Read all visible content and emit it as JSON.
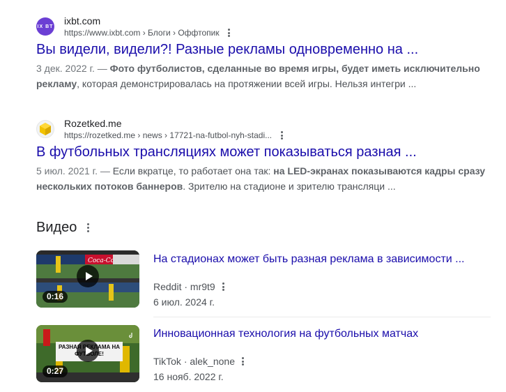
{
  "results": [
    {
      "site_name": "ixbt.com",
      "favicon_text": "IX BT",
      "url": "https://www.ixbt.com › Блоги › Оффтопик",
      "title": "Вы видели, видели?! Разные рекламы одновременно на ...",
      "date": "3 дек. 2022 г. — ",
      "snippet_bold1": "Фото футболистов, сделанные во время игры, будет иметь исключительно рекламу",
      "snippet_rest": ", которая демонстрировалась на протяжении всей игры. Нельзя интегри ..."
    },
    {
      "site_name": "Rozetked.me",
      "url": "https://rozetked.me › news › 17721-na-futbol-nyh-stadi...",
      "title": "В футбольных трансляциях может показываться разная ...",
      "date": "5 июл. 2021 г. — ",
      "snippet_plain1": "Если вкратце, то работает она так: ",
      "snippet_bold1": "на LED-экранах показываются кадры сразу нескольких потоков баннеров",
      "snippet_rest": ". Зрителю на стадионе и зрителю трансляци ..."
    }
  ],
  "video_section": {
    "heading": "Видео",
    "items": [
      {
        "title": "На стадионах может быть разная реклама в зависимости ...",
        "source": "Reddit · mr9t9",
        "date": "6 июл. 2024 г.",
        "duration": "0:16"
      },
      {
        "title": "Инновационная технология на футбольных матчах",
        "source": "TikTok · alek_none",
        "date": "16 нояб. 2022 г.",
        "duration": "0:27",
        "overlay_text": "РАЗНАЯ РЕКЛАМА НА ФУТБОЛЕ!"
      }
    ]
  },
  "colors": {
    "link": "#1a0dab",
    "ixbt_brand": "#6b3fd4",
    "rozetked_brand": "#f2c200"
  }
}
